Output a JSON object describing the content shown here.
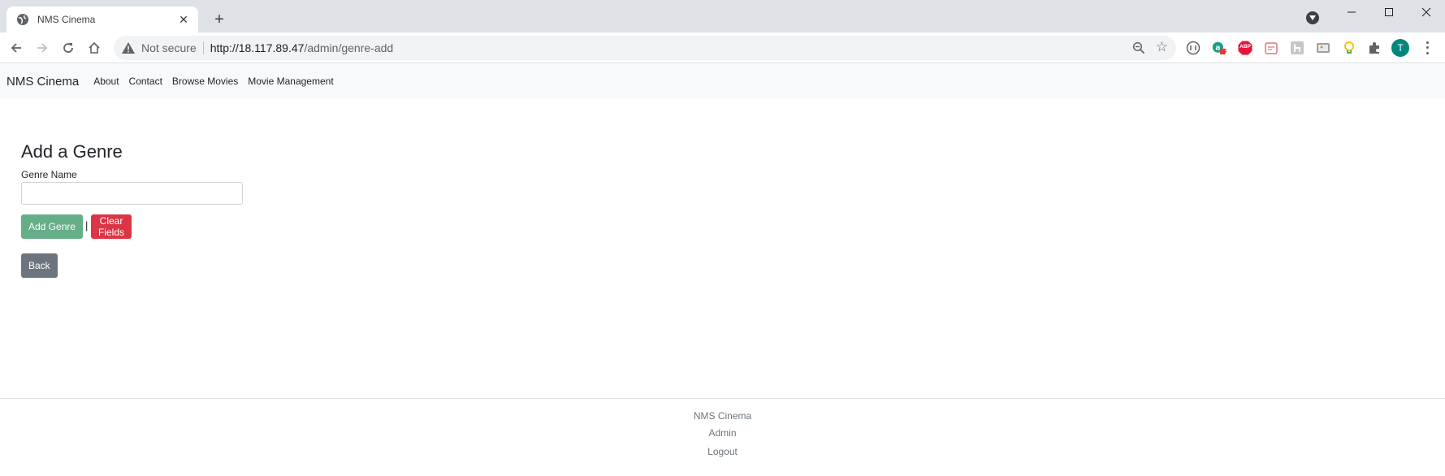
{
  "browser": {
    "tab_title": "NMS Cinema",
    "security_label": "Not secure",
    "url_host": "http://18.117.89.47",
    "url_path": "/admin/genre-add",
    "avatar_letter": "T",
    "ext_badge": "2",
    "ext_abp": "ABP"
  },
  "navbar": {
    "brand": "NMS Cinema",
    "links": [
      "About",
      "Contact",
      "Browse Movies",
      "Movie Management"
    ]
  },
  "form": {
    "title": "Add a Genre",
    "genre_label": "Genre Name",
    "genre_value": "",
    "add_button": "Add Genre",
    "separator": "|",
    "clear_button": "Clear Fields",
    "back_button": "Back"
  },
  "footer": {
    "brand": "NMS Cinema",
    "admin": "Admin",
    "logout": "Logout"
  },
  "colors": {
    "add_button": "#66ae88",
    "clear_button": "#dc3545",
    "back_button": "#6c757d",
    "navbar_bg": "#f8f9fa"
  }
}
